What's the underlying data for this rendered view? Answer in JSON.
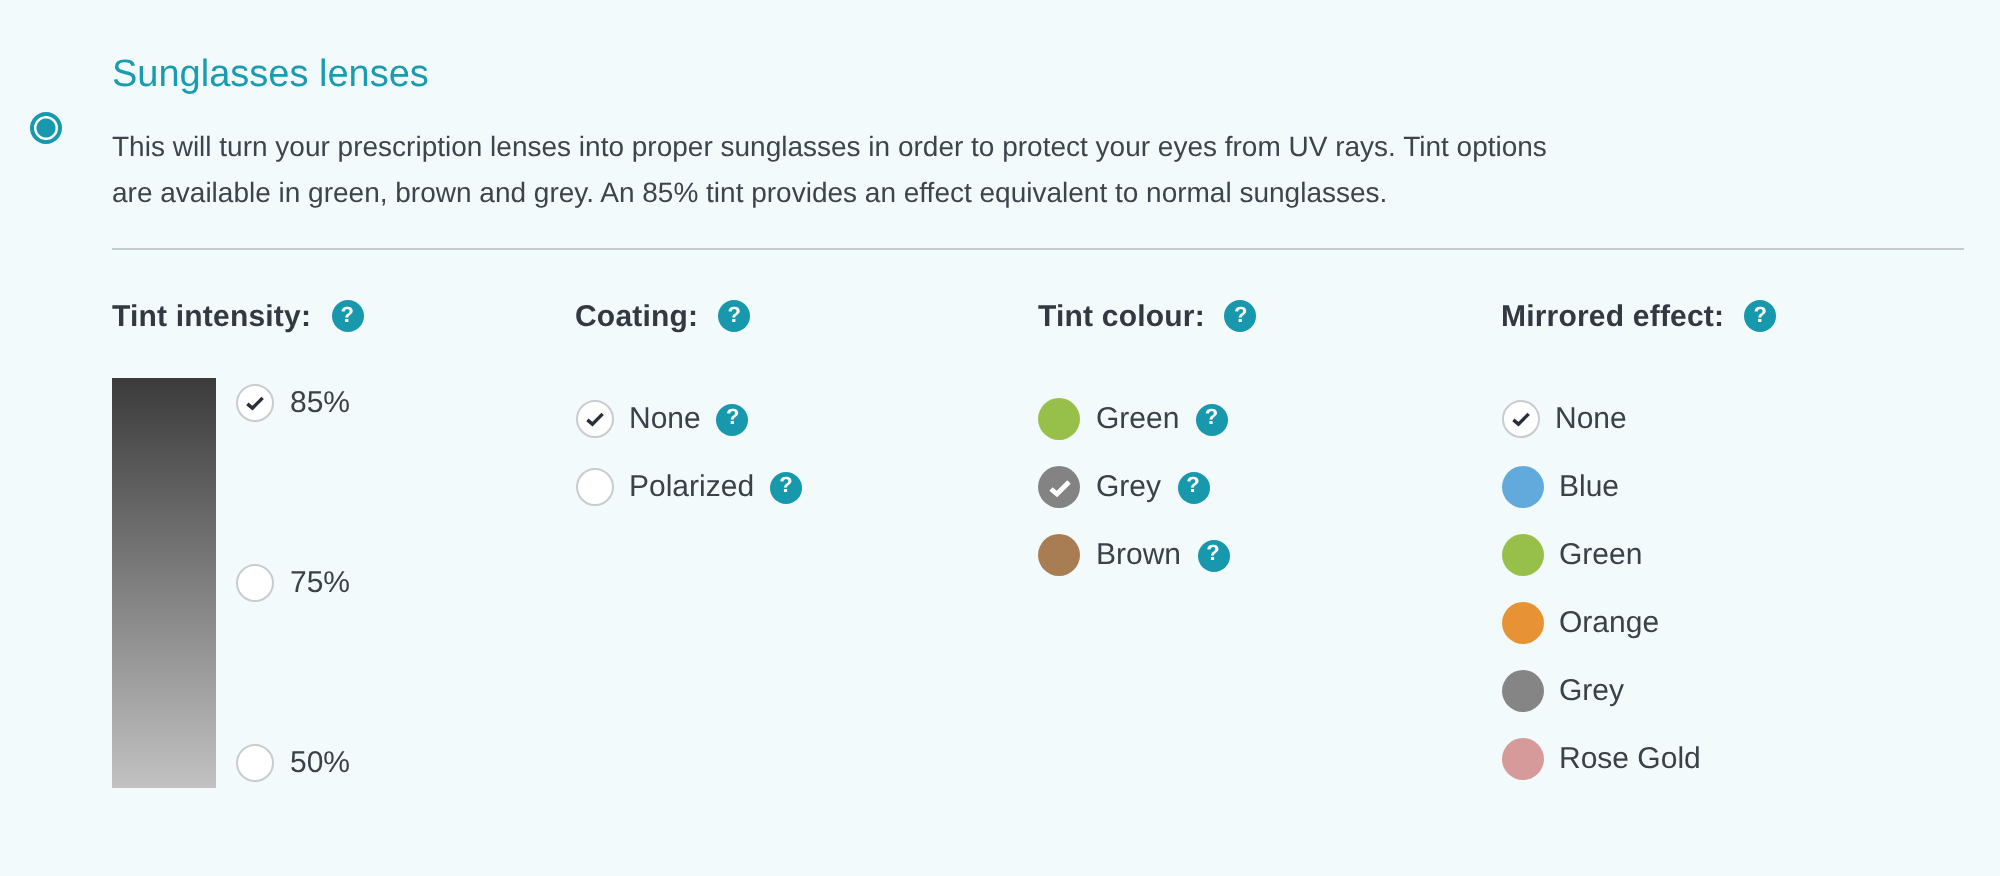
{
  "option": {
    "selected": true,
    "title": "Sunglasses lenses",
    "description": "This will turn your prescription lenses into proper sunglasses in order to protect your eyes from UV rays. Tint options are available in green, brown and grey. An 85% tint provides an effect equivalent to normal sunglasses."
  },
  "groups": [
    {
      "kind": "tint",
      "heading": "Tint intensity:",
      "help": "?",
      "items": [
        {
          "kind": "check",
          "label": "85%",
          "selected": true
        },
        {
          "kind": "check",
          "label": "75%",
          "selected": false
        },
        {
          "kind": "check",
          "label": "50%",
          "selected": false
        }
      ]
    },
    {
      "kind": "list",
      "heading": "Coating:",
      "help": "?",
      "items": [
        {
          "kind": "check",
          "label": "None",
          "selected": true,
          "help": "?"
        },
        {
          "kind": "check",
          "label": "Polarized",
          "selected": false,
          "help": "?"
        }
      ]
    },
    {
      "kind": "list",
      "heading": "Tint colour:",
      "help": "?",
      "items": [
        {
          "kind": "swatch",
          "label": "Green",
          "selected": false,
          "color": "#97c04a",
          "help": "?"
        },
        {
          "kind": "swatch",
          "label": "Grey",
          "selected": true,
          "color": "#838383",
          "help": "?"
        },
        {
          "kind": "swatch",
          "label": "Brown",
          "selected": false,
          "color": "#a97d54",
          "help": "?"
        }
      ]
    },
    {
      "kind": "list",
      "heading": "Mirrored effect:",
      "help": "?",
      "items": [
        {
          "kind": "check",
          "label": "None",
          "selected": true
        },
        {
          "kind": "swatch",
          "label": "Blue",
          "selected": false,
          "color": "#62aadc"
        },
        {
          "kind": "swatch",
          "label": "Green",
          "selected": false,
          "color": "#97c04a"
        },
        {
          "kind": "swatch",
          "label": "Orange",
          "selected": false,
          "color": "#e89236"
        },
        {
          "kind": "swatch",
          "label": "Grey",
          "selected": false,
          "color": "#858585"
        },
        {
          "kind": "swatch",
          "label": "Rose Gold",
          "selected": false,
          "color": "#d69a9a"
        }
      ]
    }
  ]
}
